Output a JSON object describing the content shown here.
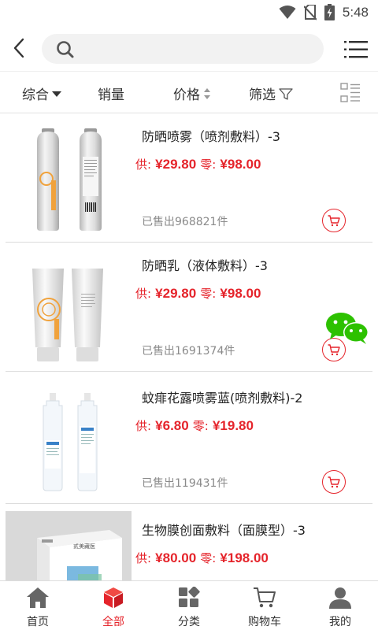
{
  "status_bar": {
    "time": "5:48"
  },
  "search": {
    "placeholder": "",
    "value": ""
  },
  "filters": [
    {
      "label": "综合"
    },
    {
      "label": "销量"
    },
    {
      "label": "价格"
    },
    {
      "label": "筛选"
    }
  ],
  "products": [
    {
      "title": "防晒喷雾（喷剂敷料）-3",
      "supply_label": "供:",
      "supply_price": "¥29.80",
      "retail_label": "零:",
      "retail_price": "¥98.00",
      "sold": "已售出968821件"
    },
    {
      "title": "防晒乳（液体敷料）-3",
      "supply_label": "供:",
      "supply_price": "¥29.80",
      "retail_label": "零:",
      "retail_price": "¥98.00",
      "sold": "已售出1691374件"
    },
    {
      "title": "蚊痱花露喷雾蓝(喷剂敷料)-2",
      "supply_label": "供:",
      "supply_price": "¥6.80",
      "retail_label": "零:",
      "retail_price": "¥19.80",
      "sold": "已售出119431件"
    },
    {
      "title": "生物膜创面敷料（面膜型）-3",
      "supply_label": "供:",
      "supply_price": "¥80.00",
      "retail_label": "零:",
      "retail_price": "¥198.00",
      "sold": ""
    }
  ],
  "product_image_text": {
    "box_brand": "贰美藏医"
  },
  "tabs": [
    {
      "label": "首页",
      "icon": "home-icon"
    },
    {
      "label": "全部",
      "icon": "cube-icon",
      "active": true
    },
    {
      "label": "分类",
      "icon": "category-icon"
    },
    {
      "label": "购物车",
      "icon": "cart-icon"
    },
    {
      "label": "我的",
      "icon": "user-icon"
    }
  ],
  "colors": {
    "accent": "#e5242b",
    "wechat": "#2dc100",
    "text": "#222222",
    "muted": "#8a8a8a"
  }
}
